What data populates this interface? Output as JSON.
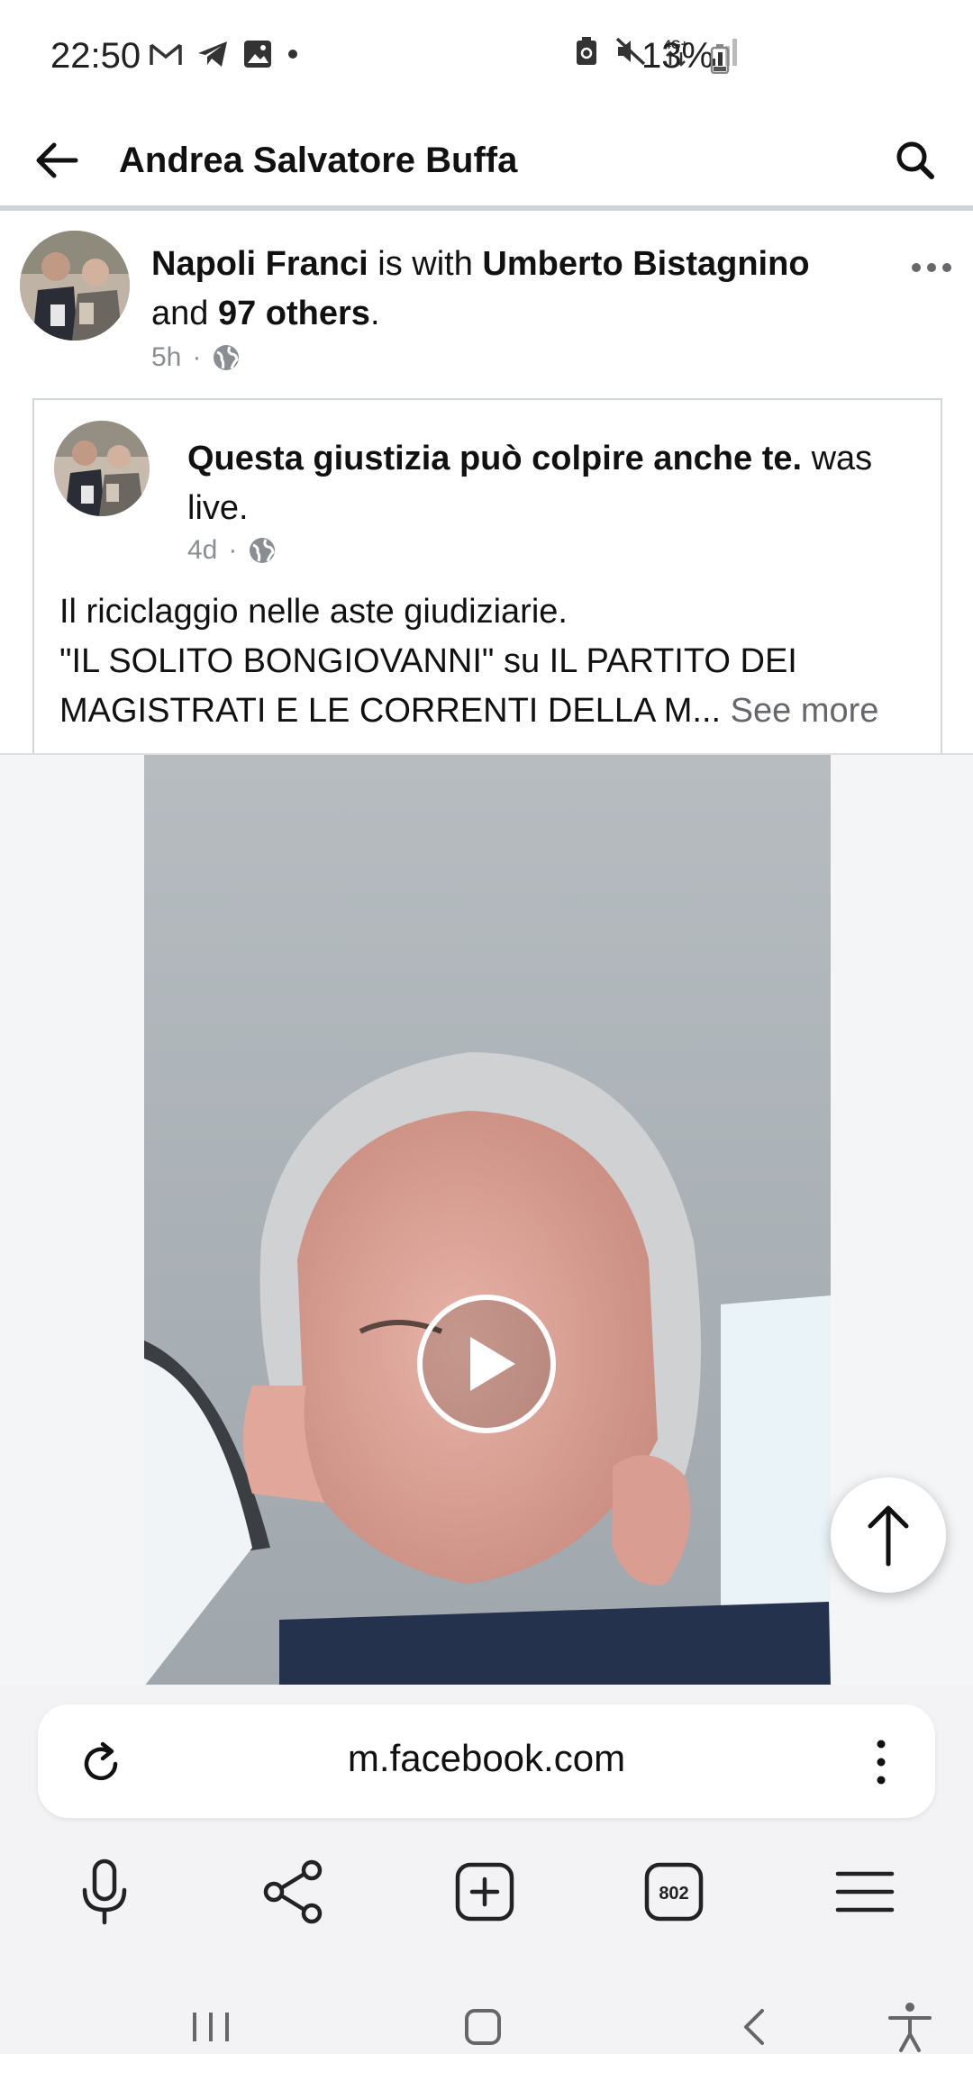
{
  "status_bar": {
    "time": "22:50",
    "battery": "13%",
    "left_icons": [
      "gmail-icon",
      "telegram-icon",
      "gallery-icon",
      "dot-icon"
    ],
    "right_icons": [
      "battery-saver-icon",
      "mute-icon",
      "4g-icon",
      "signal-icon"
    ]
  },
  "header": {
    "title": "Andrea Salvatore Buffa"
  },
  "post": {
    "author": "Napoli Franci",
    "with_text": " is with ",
    "tagged": "Umberto Bistagnino",
    "and_text": "and ",
    "others": "97 others",
    "period": ".",
    "time": "5h",
    "separator": "·"
  },
  "shared": {
    "page_name": "Questa giustizia può colpire anche te.",
    "action": " was live.",
    "time": "4d",
    "separator": "·",
    "body_line1": "Il riciclaggio nelle aste giudiziarie.",
    "body_line2": "\"IL SOLITO BONGIOVANNI\" su IL PARTITO DEI",
    "body_line3": "MAGISTRATI E LE CORRENTI DELLA M...",
    "see_more": "See more"
  },
  "browser": {
    "url": "m.facebook.com",
    "tabs_count": "802"
  }
}
